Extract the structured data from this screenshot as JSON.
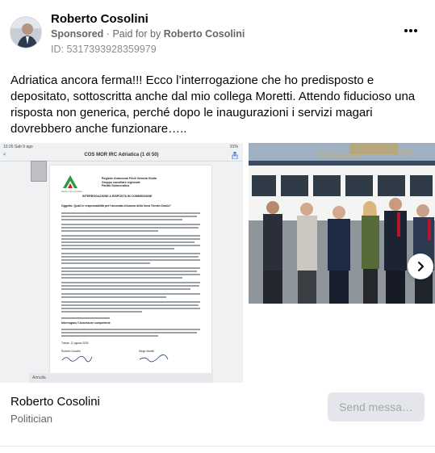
{
  "post": {
    "author": "Roberto Cosolini",
    "sponsored": "Sponsored",
    "separator": "·",
    "paid_for_by": "Paid for by",
    "paid_for_name": "Roberto Cosolini",
    "ad_id": "ID: 5317393928359979",
    "text": "Adriatica ancora ferma!!! Ecco l’interrogazione che ho predisposto e depositato, sottoscritta anche dal mio collega Moretti. Attendo fiducioso una risposta non generica, perché dopo le inaugurazioni i servizi magari dovrebbero anche funzionare…..",
    "more_icon": "more-horizontal-icon"
  },
  "carousel": {
    "slide1": {
      "status_time": "10:26 Sab 9 ago",
      "status_right": "91%",
      "mail_back": "<",
      "mail_subject": "COS MOR IRC Adriatica (1 di 50)",
      "doc_org_1": "Regione Autonoma Friuli Venezia Giulia",
      "doc_org_2": "Gruppo consiliare regionale",
      "doc_org_3": "Partito Democratico",
      "doc_heading": "INTERROGAZIONE A RISPOSTA IN COMMISSIONE",
      "doc_object": "Oggetto: Quali le responsabilità per l’anomala chiusura della linea Trieste-Grado?",
      "doc_section": "Interrogano l’Assessore competente",
      "doc_closing": "Trieste, 12 agosto 2025",
      "doc_sig_1": "Roberto Cosolini",
      "doc_sig_2": "Diego Moretti",
      "bottom_left": "Annulla"
    },
    "slide2": {
      "sign_text": "Consorzio",
      "sign_text_2": "hip"
    },
    "next_icon": "chevron-right-icon"
  },
  "footer": {
    "page_name": "Roberto Cosolini",
    "page_category": "Politician",
    "cta_label": "Send messa…"
  }
}
